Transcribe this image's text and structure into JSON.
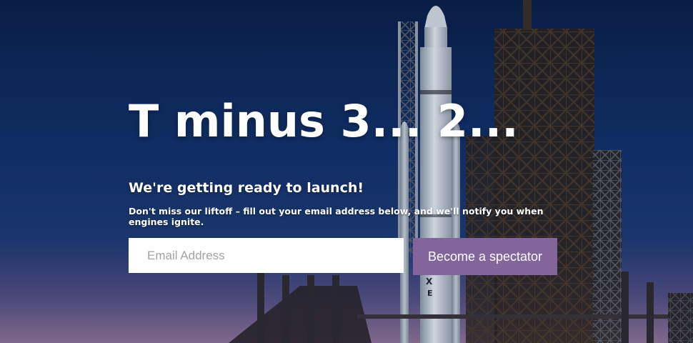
{
  "hero": {
    "headline": "T minus 3... 2...",
    "subheading": "We're getting ready to launch!",
    "description": "Don't miss our liftoff – fill out your email address below, and we'll notify you when engines ignite."
  },
  "signup": {
    "email_placeholder": "Email Address",
    "email_value": "",
    "submit_label": "Become a spectator"
  },
  "colors": {
    "button": "#82659a",
    "sky_top": "#0a1f47",
    "sky_bottom": "#6a5a8a",
    "text": "#ffffff"
  }
}
